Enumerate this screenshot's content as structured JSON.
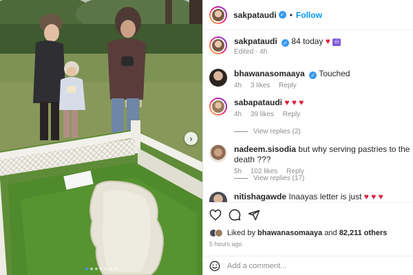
{
  "post": {
    "author": "sakpataudi",
    "follow_label": "Follow",
    "separator": "•",
    "caption_text": "84 today",
    "caption_hearts": "♥",
    "caption_emoji": "♾",
    "edited_label": "Edited",
    "edited_time": "4h"
  },
  "comments": [
    {
      "username": "bhawanasomaaya",
      "verified": true,
      "text": "Touched",
      "time": "4h",
      "likes": "3 likes",
      "reply_label": "Reply"
    },
    {
      "username": "sabapataudi",
      "verified": false,
      "text": "",
      "hearts": "♥ ♥ ♥",
      "time": "4h",
      "likes": "39 likes",
      "reply_label": "Reply",
      "view_replies": "View replies (2)"
    },
    {
      "username": "nadeem.sisodia",
      "verified": false,
      "text": "but why serving pastries to the death ???",
      "time": "5h",
      "likes": "102 likes",
      "reply_label": "Reply",
      "view_replies": "View replies (17)"
    },
    {
      "username": "nitishagawde",
      "verified": false,
      "text": "Inaayas letter is just",
      "hearts": "♥ ♥ ♥"
    }
  ],
  "actions": {
    "icons": [
      "heart-icon",
      "comment-icon",
      "share-icon"
    ],
    "liked_by_prefix": "Liked by",
    "liked_by_user": "bhawanasomaaya",
    "liked_by_and": "and",
    "liked_by_others": "82,211 others",
    "posted_time": "5 hours ago"
  },
  "add_comment": {
    "placeholder": "Add a comment..."
  },
  "media": {
    "next_icon": "›",
    "carousel_count": 7,
    "carousel_active": 1
  },
  "colors": {
    "link": "#0095f6",
    "verified": "#3897f0",
    "heart": "#e0213a",
    "muted": "#8e8e8e"
  }
}
